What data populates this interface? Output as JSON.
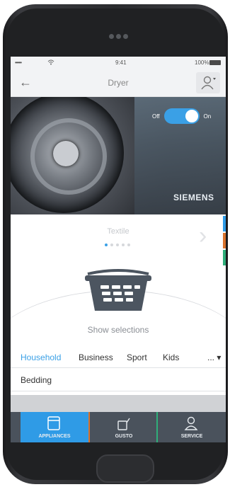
{
  "status_bar": {
    "signal": "•••••",
    "time": "9:41",
    "battery": "100%"
  },
  "nav": {
    "back_icon": "←",
    "title": "Dryer"
  },
  "hero": {
    "toggle_off": "Off",
    "toggle_on": "On",
    "brand": "SIEMENS"
  },
  "carousel": {
    "label": "Textile"
  },
  "basket": {
    "show_selections": "Show selections"
  },
  "categories": [
    "Household",
    "Business",
    "Sport",
    "Kids"
  ],
  "categories_more": "... ▾",
  "options": [
    "Bedding"
  ],
  "tabs": [
    "APPLIANCES",
    "GUSTO",
    "SERVICE"
  ],
  "colors": {
    "accent": "#2f9be6",
    "tabbar": "#4a525c",
    "gusto_stripe": "#d9732e",
    "service_stripe": "#2fae7a"
  }
}
